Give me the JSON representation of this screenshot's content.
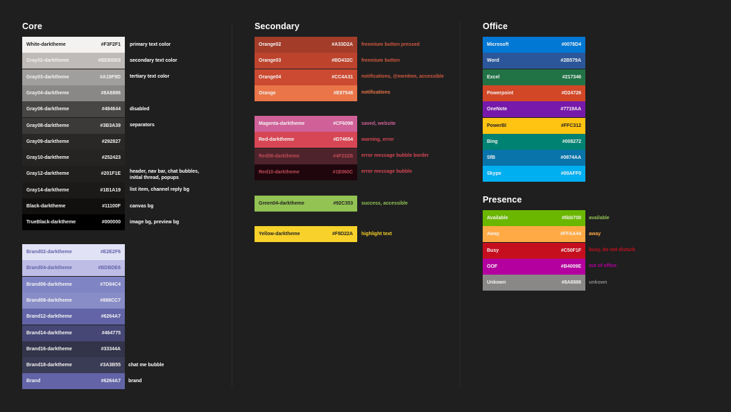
{
  "core": {
    "heading": "Core",
    "swatches": [
      {
        "name": "White-darktheme",
        "hex": "#F3F2F1",
        "bg": "#F3F2F1",
        "fg": "#252423",
        "note": "primary text color",
        "noteColor": "#ffffff"
      },
      {
        "name": "Gray02-darktheme",
        "hex": "#BEBBB8",
        "bg": "#BEBBB8",
        "fg": "#F3F2F1",
        "note": "secondary text color",
        "noteColor": "#ffffff"
      },
      {
        "name": "Gray03-darktheme",
        "hex": "#A19F9D",
        "bg": "#A19F9D",
        "fg": "#F3F2F1",
        "note": "tertiary text color",
        "noteColor": "#ffffff"
      },
      {
        "name": "Gray04-darktheme",
        "hex": "#8A8886",
        "bg": "#8A8886",
        "fg": "#F3F2F1",
        "note": "",
        "noteColor": "#ffffff"
      },
      {
        "name": "Gray06-darktheme",
        "hex": "#484644",
        "bg": "#484644",
        "fg": "#F3F2F1",
        "note": "disabled",
        "noteColor": "#ffffff"
      },
      {
        "name": "Gray08-darktheme",
        "hex": "#3B3A39",
        "bg": "#3B3A39",
        "fg": "#F3F2F1",
        "note": "separators",
        "noteColor": "#ffffff"
      },
      {
        "name": "Gray09-darktheme",
        "hex": "#292827",
        "bg": "#292827",
        "fg": "#F3F2F1",
        "note": "",
        "noteColor": "#ffffff"
      },
      {
        "name": "Gray10-darktheme",
        "hex": "#252423",
        "bg": "#252423",
        "fg": "#F3F2F1",
        "note": "",
        "noteColor": "#ffffff"
      },
      {
        "name": "Gray12-darktheme",
        "hex": "#201F1E",
        "bg": "#201F1E",
        "fg": "#F3F2F1",
        "note": "header, nav bar, chat bubbles,",
        "note2": "initial thread, popups",
        "noteColor": "#ffffff"
      },
      {
        "name": "Gray14-darktheme",
        "hex": "#1B1A19",
        "bg": "#1B1A19",
        "fg": "#F3F2F1",
        "note": "list item, channel reply bg",
        "noteColor": "#ffffff"
      },
      {
        "name": "Black-darktheme",
        "hex": "#11100F",
        "bg": "#11100F",
        "fg": "#F3F2F1",
        "note": "canvas bg",
        "noteColor": "#ffffff"
      },
      {
        "name": "TrueBlack-darktheme",
        "hex": "#000000",
        "bg": "#000000",
        "fg": "#F3F2F1",
        "note": "image bg, preview bg",
        "noteColor": "#ffffff"
      }
    ],
    "brand": [
      {
        "name": "Brand02-darktheme",
        "hex": "#E2E2F6",
        "bg": "#E2E2F6",
        "fg": "#6264A7",
        "note": ""
      },
      {
        "name": "Brand04-darktheme",
        "hex": "#BDBDE6",
        "bg": "#BDBDE6",
        "fg": "#6264A7",
        "note": ""
      },
      {
        "name": "Brand06-darktheme",
        "hex": "#7D84C4",
        "bg": "#7F85C4",
        "fg": "#F3F2F1",
        "note": ""
      },
      {
        "name": "Brand08-darktheme",
        "hex": "#888CC7",
        "bg": "#888CC7",
        "fg": "#F3F2F1",
        "note": ""
      },
      {
        "name": "Brand12-darktheme",
        "hex": "#6264A7",
        "bg": "#6264A7",
        "fg": "#F3F2F1",
        "note": ""
      },
      {
        "name": "Brand14-darktheme",
        "hex": "#464775",
        "bg": "#464775",
        "fg": "#F3F2F1",
        "note": ""
      },
      {
        "name": "Brand16-darktheme",
        "hex": "#33344A",
        "bg": "#33344A",
        "fg": "#F3F2F1",
        "note": ""
      },
      {
        "name": "Brand18-darktheme",
        "hex": "#3A3B55",
        "bg": "#3A3B55",
        "fg": "#F3F2F1",
        "note": "chat me bubble"
      },
      {
        "name": "Brand",
        "hex": "#6264A7",
        "bg": "#6264A7",
        "fg": "#F3F2F1",
        "note": "brand"
      }
    ]
  },
  "secondary": {
    "heading": "Secondary",
    "groups": [
      [
        {
          "name": "Orange02",
          "hex": "#A33D2A",
          "bg": "#A33D2A",
          "fg": "#F3F2F1",
          "note": "freemium button pressed",
          "noteColor": "#D0583E"
        },
        {
          "name": "Orange03",
          "hex": "#BD432C",
          "bg": "#BD432C",
          "fg": "#F3F2F1",
          "note": "freemium button",
          "noteColor": "#D0583E"
        },
        {
          "name": "Orange04",
          "hex": "#CC4A31",
          "bg": "#CC4A31",
          "fg": "#F3F2F1",
          "note": "notifications, @mention, accessible",
          "noteColor": "#D0583E"
        },
        {
          "name": "Orange",
          "hex": "#E97548",
          "bg": "#E97548",
          "fg": "#F3F2F1",
          "note": "notifications",
          "noteColor": "#E97548"
        }
      ],
      [
        {
          "name": "Magenta-darktheme",
          "hex": "#CF6098",
          "bg": "#CF6098",
          "fg": "#F3F2F1",
          "note": "saved, website",
          "noteColor": "#CF6098"
        },
        {
          "name": "Red-darktheme",
          "hex": "#D74654",
          "bg": "#D74654",
          "fg": "#F3F2F1",
          "note": "warning, error",
          "noteColor": "#D74654"
        },
        {
          "name": "Red08-darktheme",
          "hex": "#4F232B",
          "bg": "#4F232B",
          "fg": "#C04B58",
          "note": "error message bubble border",
          "noteColor": "#D74654"
        },
        {
          "name": "Red10-darktheme",
          "hex": "#1E060C",
          "bg": "#1E060C",
          "fg": "#C04B58",
          "note": "error message bubble",
          "noteColor": "#D74654"
        }
      ],
      [
        {
          "name": "Green04-darktheme",
          "hex": "#92C353",
          "bg": "#92C353",
          "fg": "#252423",
          "note": "success, accessible",
          "noteColor": "#92C353"
        }
      ],
      [
        {
          "name": "Yellow-darktheme",
          "hex": "#F8D22A",
          "bg": "#F8D22A",
          "fg": "#252423",
          "note": "highlight text",
          "noteColor": "#F8D22A"
        }
      ]
    ]
  },
  "office": {
    "heading": "Office",
    "swatches": [
      {
        "name": "Microsoft",
        "hex": "#0078D4",
        "bg": "#0078D4",
        "fg": "#F3F2F1"
      },
      {
        "name": "Word",
        "hex": "#2B579A",
        "bg": "#2B579A",
        "fg": "#F3F2F1"
      },
      {
        "name": "Excel",
        "hex": "#217346",
        "bg": "#217346",
        "fg": "#F3F2F1"
      },
      {
        "name": "Powerpoint",
        "hex": "#D24726",
        "bg": "#D24726",
        "fg": "#F3F2F1"
      },
      {
        "name": "OneNote",
        "hex": "#7719AA",
        "bg": "#7719AA",
        "fg": "#F3F2F1"
      },
      {
        "name": "PowerBI",
        "hex": "#FFC312",
        "bg": "#FFC312",
        "fg": "#252423"
      },
      {
        "name": "Bing",
        "hex": "#008272",
        "bg": "#008272",
        "fg": "#F3F2F1"
      },
      {
        "name": "SfB",
        "hex": "#0874AA",
        "bg": "#0874AA",
        "fg": "#F3F2F1"
      },
      {
        "name": "Skype",
        "hex": "#00AFF0",
        "bg": "#00AFF0",
        "fg": "#F3F2F1"
      }
    ]
  },
  "presence": {
    "heading": "Presence",
    "swatches": [
      {
        "name": "Available",
        "hex": "#6bb700",
        "bg": "#6BB700",
        "fg": "#F3F2F1",
        "note": "available",
        "noteColor": "#92C353"
      },
      {
        "name": "Away",
        "hex": "#FFAA44",
        "bg": "#FFAA44",
        "fg": "#F3F2F1",
        "note": "away",
        "noteColor": "#FFAA44"
      },
      {
        "name": "Busy",
        "hex": "#C50F1F",
        "bg": "#C50F1F",
        "fg": "#F3F2F1",
        "note": "busy, do not disturb",
        "noteColor": "#C50F1F"
      },
      {
        "name": "OOF",
        "hex": "#B4009E",
        "bg": "#B4009E",
        "fg": "#F3F2F1",
        "note": "out of office",
        "noteColor": "#B4009E"
      },
      {
        "name": "Unkown",
        "hex": "#8A8886",
        "bg": "#8A8886",
        "fg": "#F3F2F1",
        "note": "unkown",
        "noteColor": "#8A8886"
      }
    ]
  }
}
